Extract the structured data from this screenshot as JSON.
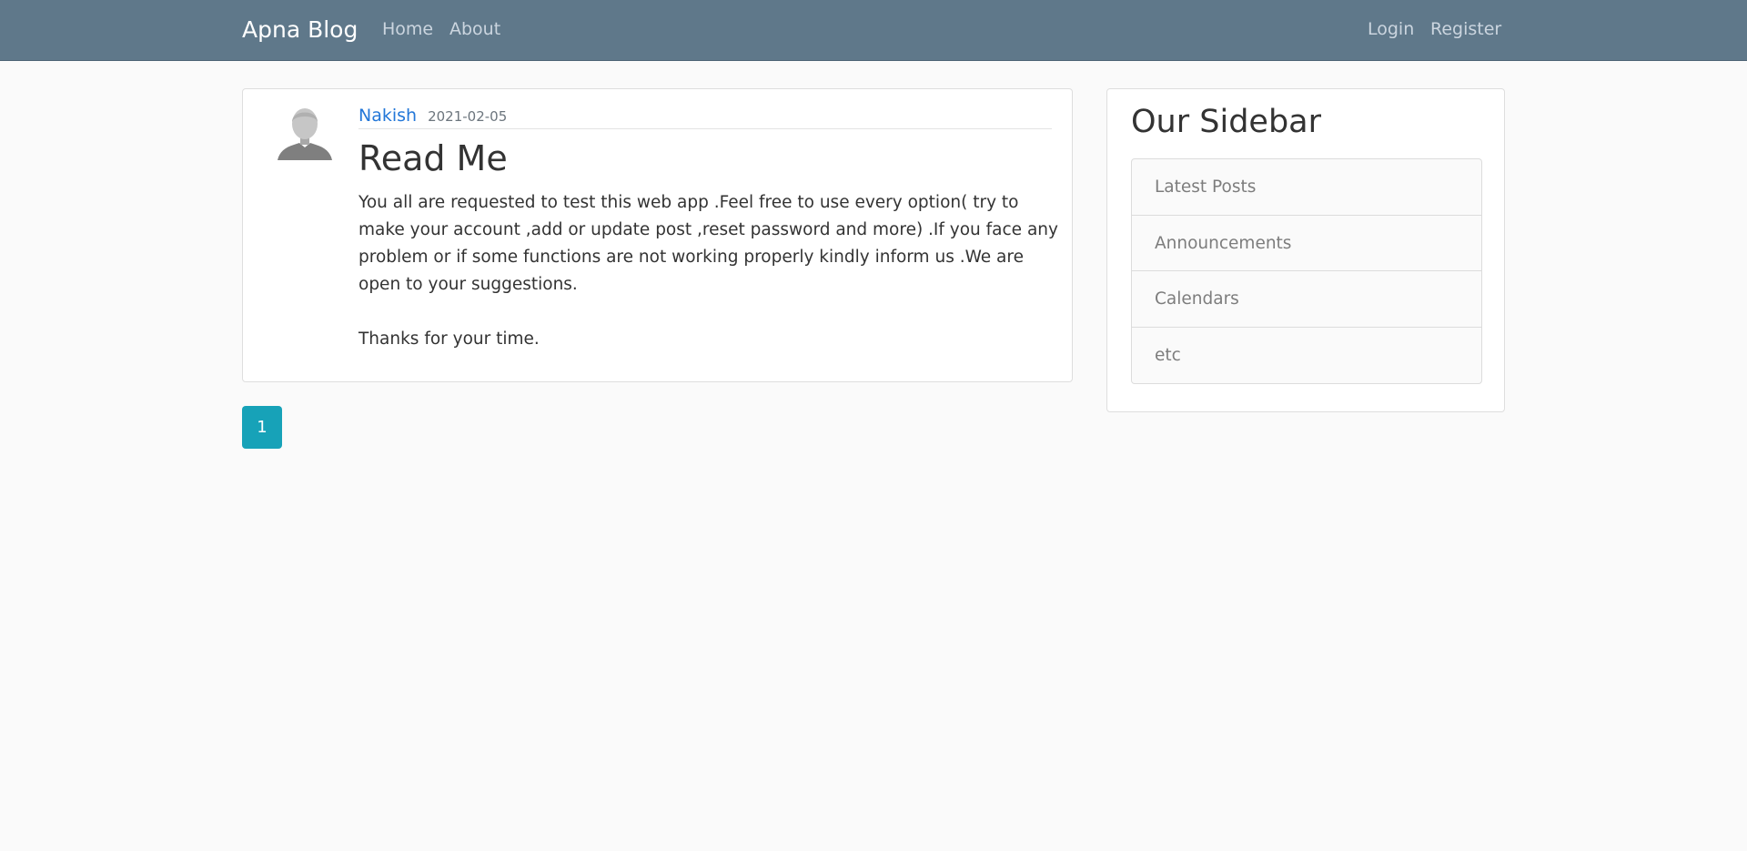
{
  "navbar": {
    "brand": "Apna Blog",
    "links": [
      "Home",
      "About"
    ],
    "auth_links": [
      "Login",
      "Register"
    ],
    "background": "#5f788a"
  },
  "post": {
    "avatar_icon": "user-silhouette-icon",
    "author": "Nakish",
    "date": "2021-02-05",
    "title": "Read Me",
    "paragraphs": [
      "You all are requested to test this web app .Feel free to use every option( try to make your account ,add or update post ,reset password and more) .If you face any problem or if some functions are not working properly kindly inform us .We are open to your suggestions.",
      "Thanks for your time."
    ]
  },
  "pagination": {
    "current_page": "1",
    "accent": "#17a2b8"
  },
  "sidebar": {
    "title": "Our Sidebar",
    "items": [
      "Latest Posts",
      "Announcements",
      "Calendars",
      "etc"
    ]
  }
}
